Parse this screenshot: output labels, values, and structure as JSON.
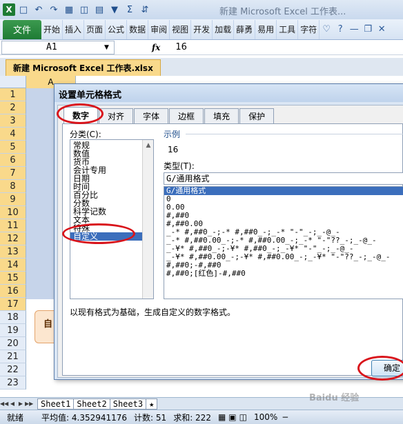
{
  "window": {
    "title": "新建 Microsoft Excel 工作表...",
    "logo": "X"
  },
  "ribbon": {
    "file_label": "文件",
    "tabs": [
      "开始",
      "插入",
      "页面",
      "公式",
      "数据",
      "审阅",
      "视图",
      "开发",
      "加载",
      "薛勇",
      "易用",
      "工具",
      "字符"
    ]
  },
  "formula_bar": {
    "name_box": "A1",
    "fx": "fx",
    "value": "16"
  },
  "workbook": {
    "name": "新建 Microsoft Excel 工作表.xlsx",
    "column_a": "A"
  },
  "rows": [
    "1",
    "2",
    "3",
    "4",
    "5",
    "6",
    "7",
    "8",
    "9",
    "10",
    "11",
    "12",
    "13",
    "14",
    "15",
    "16",
    "17",
    "18",
    "19",
    "20",
    "21",
    "22",
    "23"
  ],
  "note_text": "自",
  "sheets": [
    "Sheet1",
    "Sheet2",
    "Sheet3"
  ],
  "status": {
    "ready": "就绪",
    "average": "平均值: 4.352941176",
    "count": "计数: 51",
    "sum": "求和: 222",
    "zoom": "100%"
  },
  "dialog": {
    "title": "设置单元格格式",
    "tabs": [
      "数字",
      "对齐",
      "字体",
      "边框",
      "填充",
      "保护"
    ],
    "category_label": "分类(C):",
    "categories": [
      "常规",
      "数值",
      "货币",
      "会计专用",
      "日期",
      "时间",
      "百分比",
      "分数",
      "科学记数",
      "文本",
      "特殊",
      "自定义"
    ],
    "sample_legend": "示例",
    "sample_value": "16",
    "type_label": "类型(T):",
    "type_value": "G/通用格式",
    "formats": [
      "G/通用格式",
      "0",
      "0.00",
      "#,##0",
      "#,##0.00",
      "_-* #,##0_-;-* #,##0_-;_-* \"-\"_-;_-@_-",
      "_-* #,##0.00_-;-* #,##0.00_-;_-* \"-\"??_-;_-@_-",
      "_-¥* #,##0_-;-¥* #,##0_-;_-¥* \"-\"_-;_-@_-",
      "_-¥* #,##0.00_-;-¥* #,##0.00_-;_-¥* \"-\"??_-;_-@_-",
      "#,##0;-#,##0",
      "#,##0;[红色]-#,##0"
    ],
    "description": "以现有格式为基础，生成自定义的数字格式。",
    "ok_label": "确定"
  },
  "watermark": "Baidu 经验",
  "colors": {
    "excel_green": "#1e7b34",
    "selection": "#c6d4ea",
    "highlight": "#3b6ebc",
    "annotation_red": "#d9141b"
  }
}
